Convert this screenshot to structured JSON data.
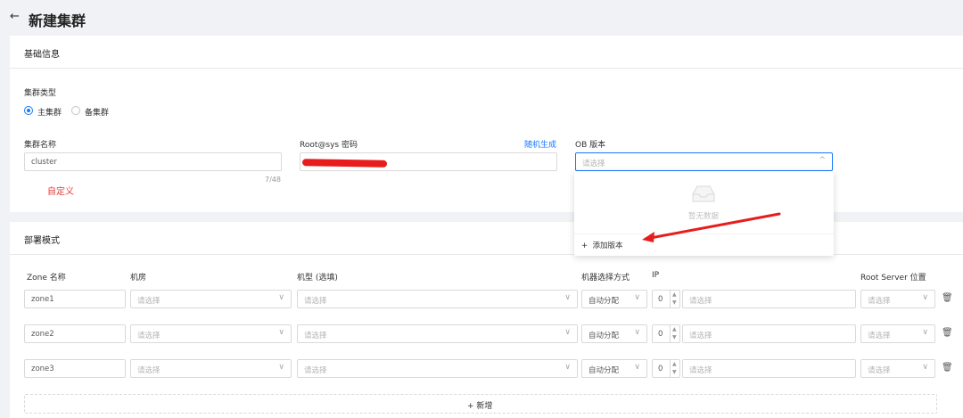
{
  "page": {
    "back_icon": "←",
    "title": "新建集群"
  },
  "basic": {
    "title": "基础信息",
    "cluster_type_label": "集群类型",
    "radio_primary": "主集群",
    "radio_standby": "备集群",
    "cluster_name_label": "集群名称",
    "cluster_name_value": "cluster",
    "cluster_name_count": "7/48",
    "custom_annotation": "自定义",
    "root_pw_label": "Root@sys 密码",
    "random_generate": "随机生成",
    "ob_version_label": "OB 版本",
    "ob_version_placeholder": "请选择",
    "ob_version_chevron": "^",
    "dropdown": {
      "empty_text": "暂无数据",
      "add_version": "添加版本",
      "plus": "+"
    }
  },
  "deploy": {
    "title": "部署模式",
    "headers": {
      "zone": "Zone 名称",
      "room": "机房",
      "model": "机型 (选填)",
      "select_method": "机器选择方式",
      "ip": "IP",
      "rs": "Root Server 位置"
    },
    "rows": [
      {
        "zone": "zone1",
        "room": "请选择",
        "model": "请选择",
        "method": "自动分配",
        "count": "0",
        "ip": "请选择",
        "rs": "请选择"
      },
      {
        "zone": "zone2",
        "room": "请选择",
        "model": "请选择",
        "method": "自动分配",
        "count": "0",
        "ip": "请选择",
        "rs": "请选择"
      },
      {
        "zone": "zone3",
        "room": "请选择",
        "model": "请选择",
        "method": "自动分配",
        "count": "0",
        "ip": "请选择",
        "rs": "请选择"
      }
    ],
    "chevron": "∨",
    "step_up": "▲",
    "step_down": "▼",
    "trash": "🗑",
    "add_plus": "+",
    "add_label": "新增"
  },
  "colors": {
    "accent": "#1677ff",
    "annotation_red": "#e53935"
  }
}
